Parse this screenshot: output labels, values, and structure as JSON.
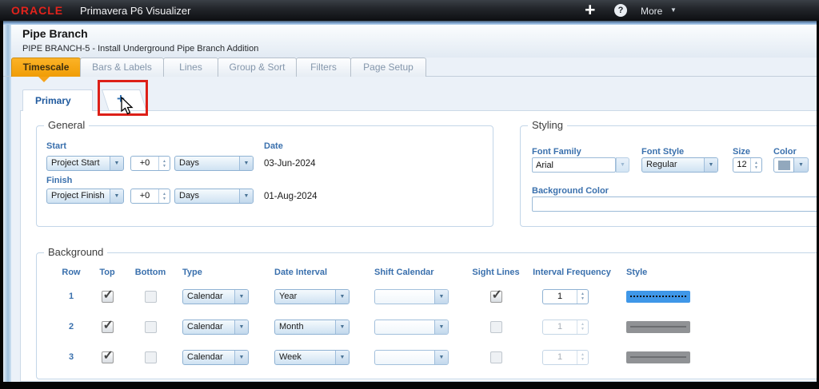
{
  "titlebar": {
    "brand": "ORACLE",
    "app_title": "Primavera P6 Visualizer",
    "plus_icon": "+",
    "help_icon": "?",
    "more_label": "More",
    "more_caret": "▼"
  },
  "header": {
    "title": "Pipe Branch",
    "subtitle": "PIPE BRANCH-5 - Install Underground Pipe Branch Addition"
  },
  "tabs": [
    {
      "label": "Timescale",
      "active": true
    },
    {
      "label": "Bars & Labels",
      "active": false
    },
    {
      "label": "Lines",
      "active": false
    },
    {
      "label": "Group & Sort",
      "active": false
    },
    {
      "label": "Filters",
      "active": false
    },
    {
      "label": "Page Setup",
      "active": false
    }
  ],
  "subtabs": {
    "primary_label": "Primary",
    "add_label": "+"
  },
  "general": {
    "legend": "General",
    "start_label": "Start",
    "finish_label": "Finish",
    "date_label": "Date",
    "start_anchor": "Project Start",
    "start_offset": "+0",
    "start_unit": "Days",
    "start_date": "03-Jun-2024",
    "finish_anchor": "Project Finish",
    "finish_offset": "+0",
    "finish_unit": "Days",
    "finish_date": "01-Aug-2024"
  },
  "styling": {
    "legend": "Styling",
    "font_family_label": "Font Family",
    "font_family": "Arial",
    "font_style_label": "Font Style",
    "font_style": "Regular",
    "size_label": "Size",
    "size": "12",
    "color_label": "Color",
    "color_swatch": "#92A8BD",
    "background_color_label": "Background Color",
    "background_color_value": ""
  },
  "background": {
    "legend": "Background",
    "columns": [
      "Row",
      "Top",
      "Bottom",
      "Type",
      "Date Interval",
      "Shift Calendar",
      "Sight Lines",
      "Interval Frequency",
      "Style"
    ],
    "rows": [
      {
        "row": "1",
        "top": true,
        "bottom": false,
        "type": "Calendar",
        "date_interval": "Year",
        "shift_calendar": "",
        "sight_lines": true,
        "interval_frequency": "1",
        "frequency_enabled": true,
        "style": "blue-dotted"
      },
      {
        "row": "2",
        "top": true,
        "bottom": false,
        "type": "Calendar",
        "date_interval": "Month",
        "shift_calendar": "",
        "sight_lines": false,
        "interval_frequency": "1",
        "frequency_enabled": false,
        "style": "gray-solid"
      },
      {
        "row": "3",
        "top": true,
        "bottom": false,
        "type": "Calendar",
        "date_interval": "Week",
        "shift_calendar": "",
        "sight_lines": false,
        "interval_frequency": "1",
        "frequency_enabled": false,
        "style": "gray-solid"
      }
    ]
  },
  "colors": {
    "accent_orange": "#F5A31A",
    "label_blue": "#3A70AD",
    "brand_red": "#E3231C",
    "style_blue": "#3F97E8",
    "style_gray": "#909295",
    "annotation_red": "#DD2018"
  }
}
